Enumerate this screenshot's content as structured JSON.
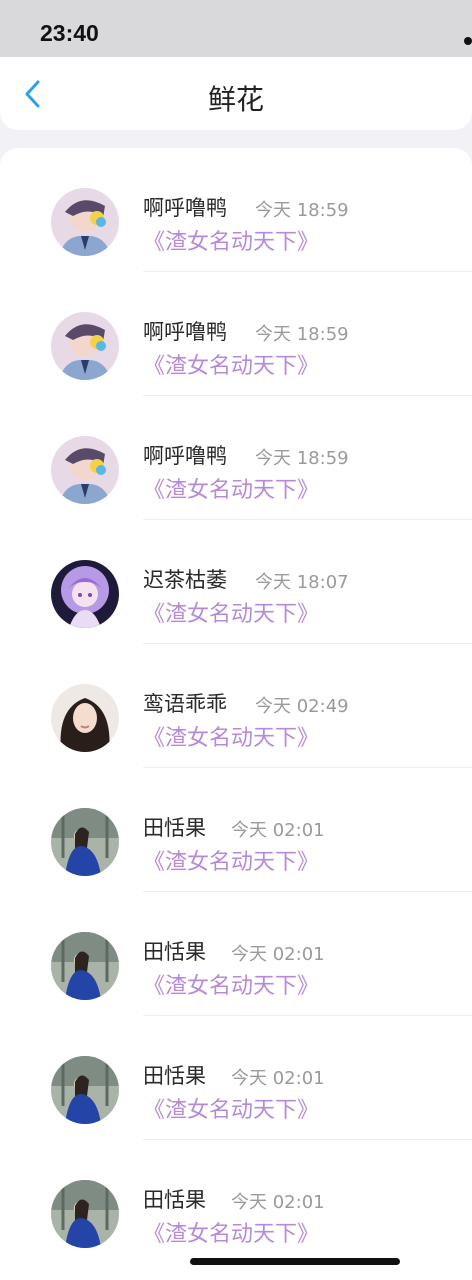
{
  "status_bar": {
    "time": "23:40"
  },
  "header": {
    "title": "鲜花",
    "back_icon": "chevron-left-icon",
    "accent": "#2ea1e6"
  },
  "rows": [
    {
      "name": "啊呼噜鸭",
      "time": "今天 18:59",
      "book": "《渣女名动天下》",
      "avatar": "anime-boy"
    },
    {
      "name": "啊呼噜鸭",
      "time": "今天 18:59",
      "book": "《渣女名动天下》",
      "avatar": "anime-boy"
    },
    {
      "name": "啊呼噜鸭",
      "time": "今天 18:59",
      "book": "《渣女名动天下》",
      "avatar": "anime-boy"
    },
    {
      "name": "迟茶枯萎",
      "time": "今天 18:07",
      "book": "《渣女名动天下》",
      "avatar": "anime-girl-purple"
    },
    {
      "name": "鸾语乖乖",
      "time": "今天 02:49",
      "book": "《渣女名动天下》",
      "avatar": "photo-woman"
    },
    {
      "name": "田恬果",
      "time": "今天 02:01",
      "book": "《渣女名动天下》",
      "avatar": "photo-blue-outfit"
    },
    {
      "name": "田恬果",
      "time": "今天 02:01",
      "book": "《渣女名动天下》",
      "avatar": "photo-blue-outfit"
    },
    {
      "name": "田恬果",
      "time": "今天 02:01",
      "book": "《渣女名动天下》",
      "avatar": "photo-blue-outfit"
    },
    {
      "name": "田恬果",
      "time": "今天 02:01",
      "book": "《渣女名动天下》",
      "avatar": "photo-blue-outfit"
    }
  ],
  "colors": {
    "book_link": "#b58ad8",
    "time_text": "#9a9a9a",
    "name_text": "#2a2a2a"
  }
}
